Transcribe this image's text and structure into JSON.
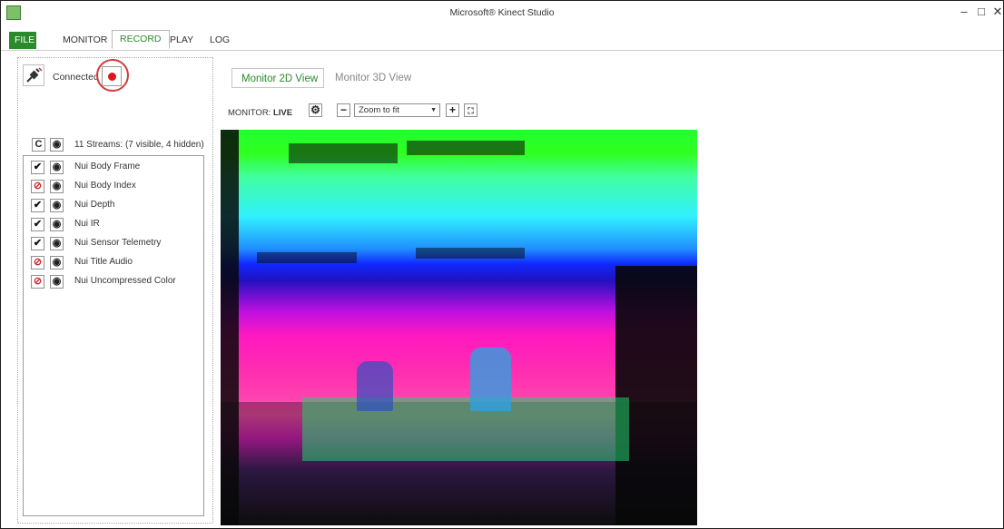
{
  "window": {
    "title": "Microsoft® Kinect Studio",
    "controls": [
      "–",
      "□",
      "✕"
    ]
  },
  "menu": {
    "tabs": [
      "FILE",
      "MONITOR",
      "RECORD",
      "PLAY",
      "LOG"
    ],
    "active": "RECORD"
  },
  "connection": {
    "status": "Connected"
  },
  "streams": {
    "header_buttons": [
      "C"
    ],
    "summary": "11 Streams: (7 visible, 4 hidden)",
    "items": [
      {
        "name": "Nui Body Frame",
        "enabled": true
      },
      {
        "name": "Nui Body Index",
        "enabled": false
      },
      {
        "name": "Nui Depth",
        "enabled": true
      },
      {
        "name": "Nui IR",
        "enabled": true
      },
      {
        "name": "Nui Sensor Telemetry",
        "enabled": true
      },
      {
        "name": "Nui Title Audio",
        "enabled": false
      },
      {
        "name": "Nui Uncompressed Color",
        "enabled": false
      }
    ]
  },
  "views": {
    "tabs": [
      "Monitor 2D View",
      "Monitor 3D View"
    ],
    "active": "Monitor 2D View"
  },
  "toolbar": {
    "label_prefix": "MONITOR:",
    "label_mode": "LIVE",
    "zoom": {
      "selected": "Zoom to fit"
    }
  },
  "colors": {
    "accent": "#2b8a2b",
    "record": "#e1141e",
    "highlight_circle": "#d33a3a",
    "disabled": "#d0262d"
  }
}
